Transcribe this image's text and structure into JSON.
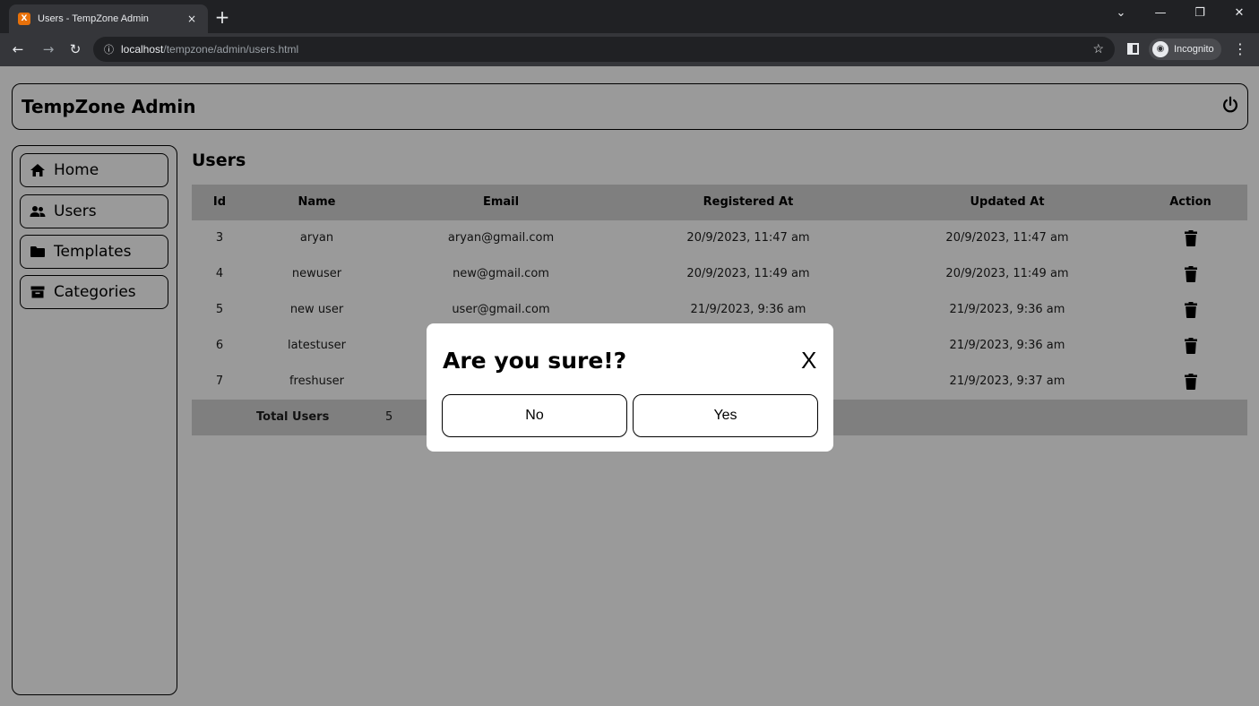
{
  "browser": {
    "tab_title": "Users - TempZone Admin",
    "tab_favicon_text": "X",
    "tab_close": "×",
    "new_tab": "+",
    "url_host": "localhost",
    "url_path": "/tempzone/admin/users.html",
    "incognito_label": "Incognito"
  },
  "header": {
    "brand": "TempZone Admin"
  },
  "sidebar": {
    "items": [
      {
        "label": "Home",
        "icon": "home-icon"
      },
      {
        "label": "Users",
        "icon": "users-icon"
      },
      {
        "label": "Templates",
        "icon": "folder-icon"
      },
      {
        "label": "Categories",
        "icon": "archive-icon"
      }
    ]
  },
  "main": {
    "title": "Users",
    "table": {
      "headers": {
        "id": "Id",
        "name": "Name",
        "email": "Email",
        "registered": "Registered At",
        "updated": "Updated At",
        "action": "Action"
      },
      "rows": [
        {
          "id": "3",
          "name": "aryan",
          "email": "aryan@gmail.com",
          "registered": "20/9/2023, 11:47 am",
          "updated": "20/9/2023, 11:47 am"
        },
        {
          "id": "4",
          "name": "newuser",
          "email": "new@gmail.com",
          "registered": "20/9/2023, 11:49 am",
          "updated": "20/9/2023, 11:49 am"
        },
        {
          "id": "5",
          "name": "new user",
          "email": "user@gmail.com",
          "registered": "21/9/2023, 9:36 am",
          "updated": "21/9/2023, 9:36 am"
        },
        {
          "id": "6",
          "name": "latestuser",
          "email": "",
          "registered": "",
          "updated": "21/9/2023, 9:36 am"
        },
        {
          "id": "7",
          "name": "freshuser",
          "email": "",
          "registered": "",
          "updated": "21/9/2023, 9:37 am"
        }
      ],
      "footer": {
        "label": "Total Users",
        "count": "5"
      }
    }
  },
  "modal": {
    "title": "Are you sure!?",
    "close": "X",
    "no_label": "No",
    "yes_label": "Yes"
  },
  "colors": {
    "overlay": "#9a9a9a",
    "table_header": "#7f7f7f",
    "modal_bg": "#ffffff"
  }
}
